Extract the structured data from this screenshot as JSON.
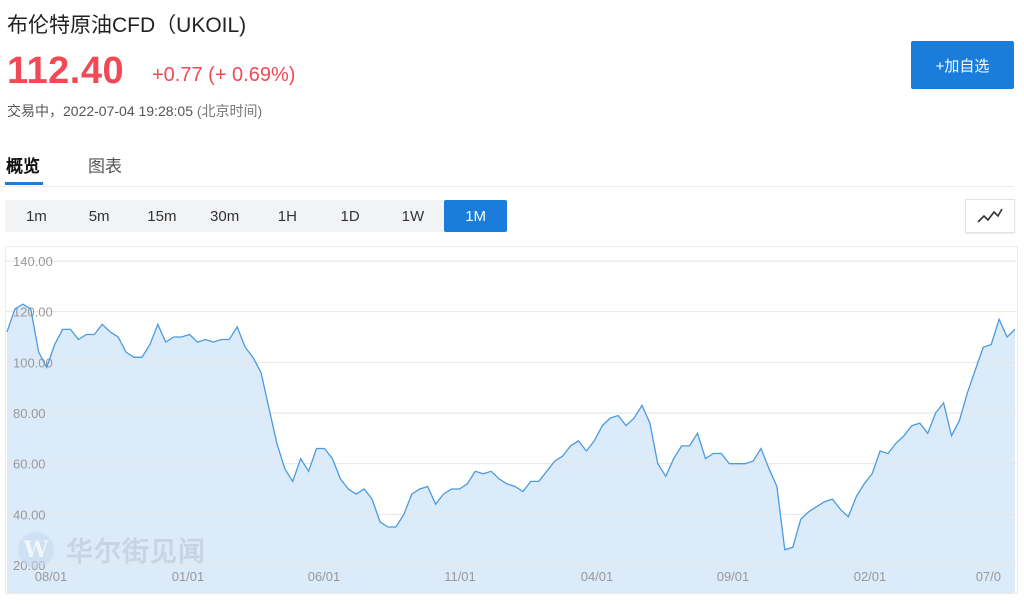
{
  "header": {
    "title": "布伦特原油CFD（UKOIL)",
    "price": "112.40",
    "change": "+0.77 (+ 0.69%)",
    "status": "交易中，",
    "timestamp": "2022-07-04 19:28:05",
    "timezone": "(北京时间)",
    "add_button": "+加自选"
  },
  "tabs": [
    {
      "label": "概览",
      "active": true
    },
    {
      "label": "图表",
      "active": false
    }
  ],
  "periods": [
    {
      "label": "1m",
      "active": false
    },
    {
      "label": "5m",
      "active": false
    },
    {
      "label": "15m",
      "active": false
    },
    {
      "label": "30m",
      "active": false
    },
    {
      "label": "1H",
      "active": false
    },
    {
      "label": "1D",
      "active": false
    },
    {
      "label": "1W",
      "active": false
    },
    {
      "label": "1M",
      "active": true
    }
  ],
  "chart_type_icon": "line-chart-icon",
  "watermark": {
    "logo": "W",
    "text": "华尔街见闻"
  },
  "colors": {
    "up": "#f24957",
    "accent": "#1a7ddc",
    "line": "#4a9be0",
    "fill": "#dcebfa"
  },
  "chart_data": {
    "type": "area",
    "y_tick_labels": [
      "140.00",
      "120.00",
      "100.00",
      "80.00",
      "60.00",
      "40.00",
      "20.00"
    ],
    "y_ticks": [
      140,
      120,
      100,
      80,
      60,
      40,
      20
    ],
    "ylim": [
      20,
      140
    ],
    "x_tick_labels": [
      "08/01",
      "01/01",
      "06/01",
      "11/01",
      "04/01",
      "09/01",
      "02/01",
      "07/0"
    ],
    "grid": true,
    "values": [
      112,
      121,
      123,
      121,
      104,
      98,
      107,
      113,
      113,
      109,
      111,
      111,
      115,
      112,
      110,
      104,
      102,
      102,
      107,
      115,
      108,
      110,
      110,
      111,
      108,
      109,
      108,
      109,
      109,
      114,
      106,
      102,
      96,
      82,
      68,
      58,
      53,
      62,
      57,
      66,
      66,
      62,
      54,
      50,
      48,
      50,
      46,
      37,
      35,
      35,
      40,
      48,
      50,
      51,
      44,
      48,
      50,
      50,
      52,
      57,
      56,
      57,
      54,
      52,
      51,
      49,
      53,
      53,
      57,
      61,
      63,
      67,
      69,
      65,
      69,
      75,
      78,
      79,
      75,
      78,
      83,
      76,
      60,
      55,
      62,
      67,
      67,
      72,
      62,
      64,
      64,
      60,
      60,
      60,
      61,
      66,
      58,
      51,
      26,
      27,
      38,
      41,
      43,
      45,
      46,
      42,
      39,
      47,
      52,
      56,
      65,
      64,
      68,
      71,
      75,
      76,
      72,
      80,
      84,
      71,
      77,
      88,
      97,
      106,
      107,
      117,
      110,
      113
    ]
  }
}
